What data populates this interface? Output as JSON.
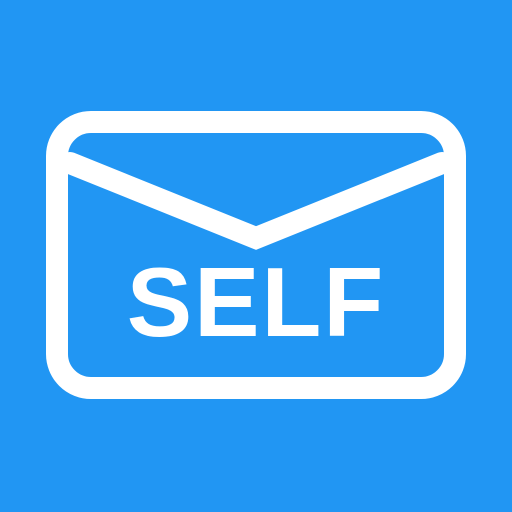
{
  "icon": {
    "name": "envelope-icon",
    "label": "SELF",
    "background_color": "#2196F3",
    "foreground_color": "#FFFFFF"
  }
}
